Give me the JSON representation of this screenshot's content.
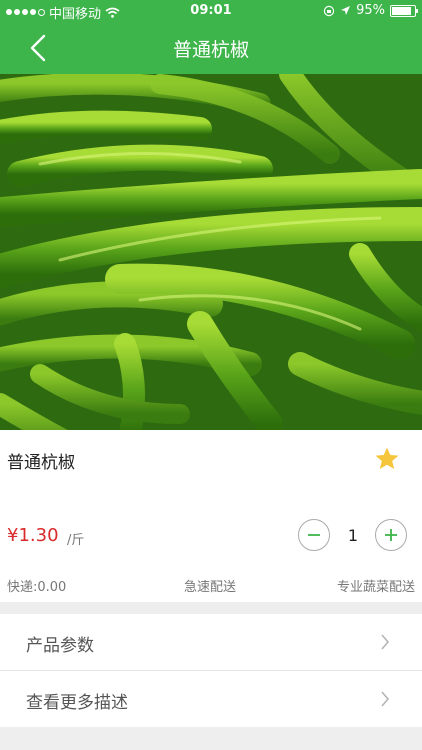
{
  "status_bar": {
    "carrier": "中国移动",
    "time": "09:01",
    "battery": "95%"
  },
  "nav": {
    "title": "普通杭椒"
  },
  "product": {
    "name": "普通杭椒",
    "price": "¥1.30",
    "unit": "/斤",
    "quantity": "1",
    "shipping": "快递:0.00",
    "tag_fast": "急速配送",
    "tag_pro": "专业蔬菜配送"
  },
  "menu": [
    {
      "label": "产品参数"
    },
    {
      "label": "查看更多描述"
    }
  ],
  "colors": {
    "brand": "#3db54a",
    "price": "#d92b2b",
    "star": "#f5c63b"
  }
}
